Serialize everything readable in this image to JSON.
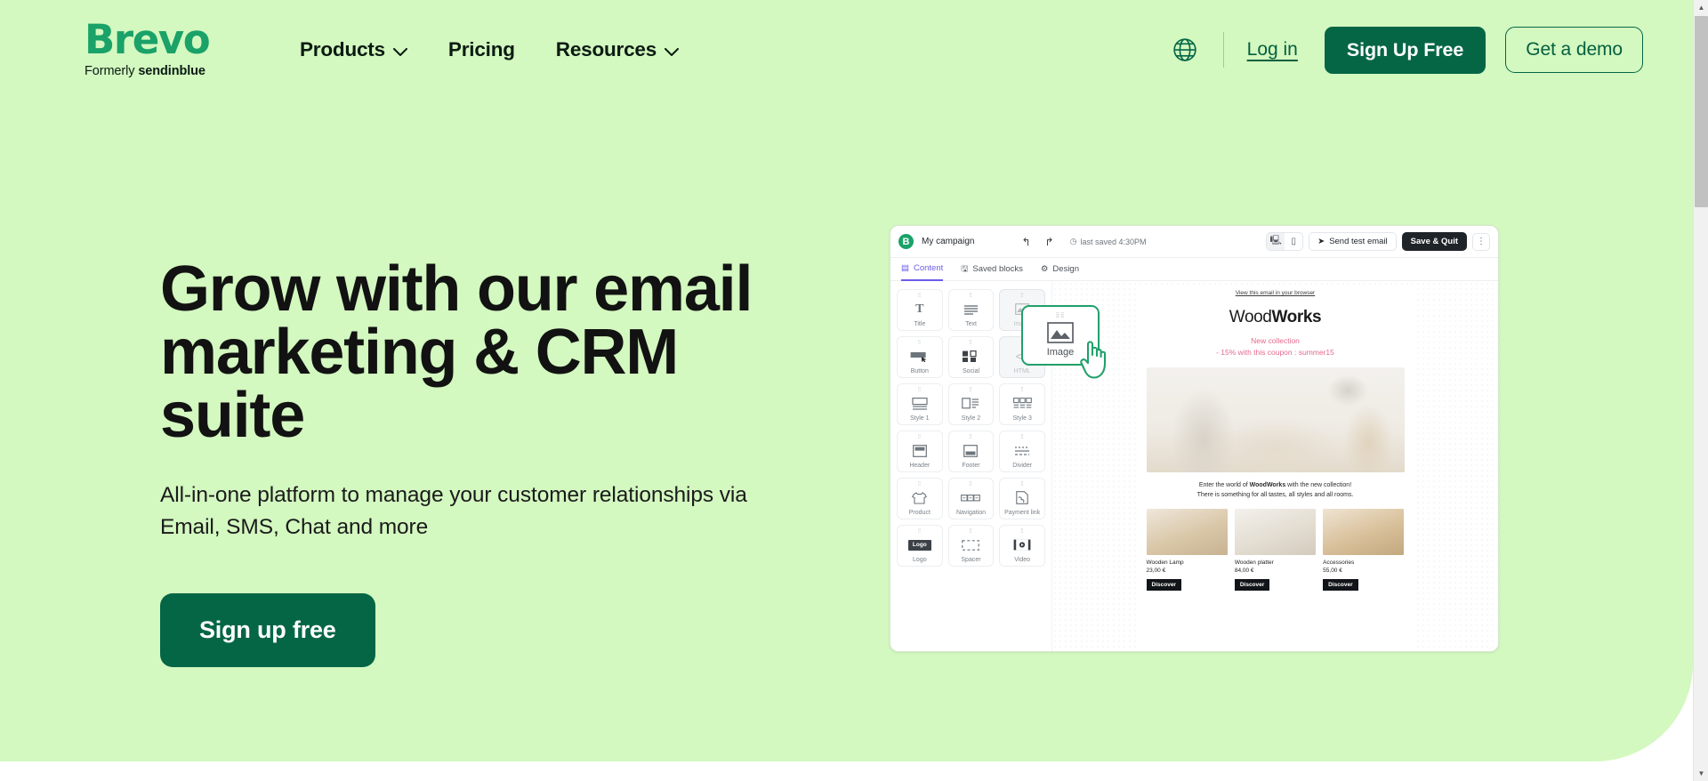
{
  "brand": {
    "logo_text": "Brevo",
    "logo_sub_prefix": "Formerly",
    "logo_sub_name": "sendinblue",
    "accent_green": "#1aa268",
    "dark_green": "#056646",
    "hero_bg": "#d3f8c0"
  },
  "nav": {
    "items": [
      {
        "label": "Products",
        "has_chevron": true
      },
      {
        "label": "Pricing",
        "has_chevron": false
      },
      {
        "label": "Resources",
        "has_chevron": true
      }
    ]
  },
  "header_actions": {
    "language_icon": "globe-icon",
    "login_label": "Log in",
    "signup_label": "Sign Up Free",
    "demo_label": "Get a demo"
  },
  "hero": {
    "headline": "Grow with our email marketing & CRM suite",
    "subhead": "All-in-one platform to manage your customer relationships via Email, SMS, Chat and more",
    "cta_label": "Sign up free"
  },
  "editor": {
    "campaign_name": "My campaign",
    "undo_icon": "undo-icon",
    "redo_icon": "redo-icon",
    "saved_status": "last saved 4:30PM",
    "desktop_icon": "desktop-icon",
    "mobile_icon": "mobile-icon",
    "send_test_label": "Send test email",
    "save_quit_label": "Save & Quit",
    "kebab_icon": "kebab-menu-icon",
    "tabs": [
      {
        "label": "Content",
        "active": true
      },
      {
        "label": "Saved blocks",
        "active": false
      },
      {
        "label": "Design",
        "active": false
      }
    ],
    "blocks": [
      {
        "label": "Title",
        "icon": "title-icon"
      },
      {
        "label": "Text",
        "icon": "text-icon"
      },
      {
        "label": "Image",
        "icon": "image-icon"
      },
      {
        "label": "Button",
        "icon": "button-icon"
      },
      {
        "label": "Social",
        "icon": "social-icon"
      },
      {
        "label": "HTML",
        "icon": "html-icon"
      },
      {
        "label": "Style 1",
        "icon": "style1-icon"
      },
      {
        "label": "Style 2",
        "icon": "style2-icon"
      },
      {
        "label": "Style 3",
        "icon": "style3-icon"
      },
      {
        "label": "Header",
        "icon": "header-icon"
      },
      {
        "label": "Footer",
        "icon": "footer-icon"
      },
      {
        "label": "Divider",
        "icon": "divider-icon"
      },
      {
        "label": "Product",
        "icon": "product-icon"
      },
      {
        "label": "Navigation",
        "icon": "navigation-icon"
      },
      {
        "label": "Payment link",
        "icon": "payment-link-icon"
      },
      {
        "label": "Logo",
        "icon": "logo-icon"
      },
      {
        "label": "Spacer",
        "icon": "spacer-icon"
      },
      {
        "label": "Video",
        "icon": "video-icon"
      }
    ],
    "dragging": {
      "label": "Image",
      "icon": "image-icon",
      "cursor": "hand-pointer-icon"
    }
  },
  "email_preview": {
    "preheader": "View this email in your browser",
    "brand_light": "Wood",
    "brand_bold": "Works",
    "promo_line1": "New collection",
    "promo_line2": "- 15% with this coupon : summer15",
    "promo_color": "#e46a8d",
    "body_line1_pre": "Enter the world of ",
    "body_line1_bold": "WoodWorks",
    "body_line1_post": " with the new collection!",
    "body_line2": "There is something for all tastes, all styles and all rooms.",
    "products": [
      {
        "name": "Wooden Lamp",
        "price": "23,00 €",
        "cta": "Discover"
      },
      {
        "name": "Wooden platter",
        "price": "84,00 €",
        "cta": "Discover"
      },
      {
        "name": "Accessories",
        "price": "55,00 €",
        "cta": "Discover"
      }
    ]
  },
  "scrollbar": {
    "up_arrow": "▲",
    "down_arrow": "▼"
  }
}
